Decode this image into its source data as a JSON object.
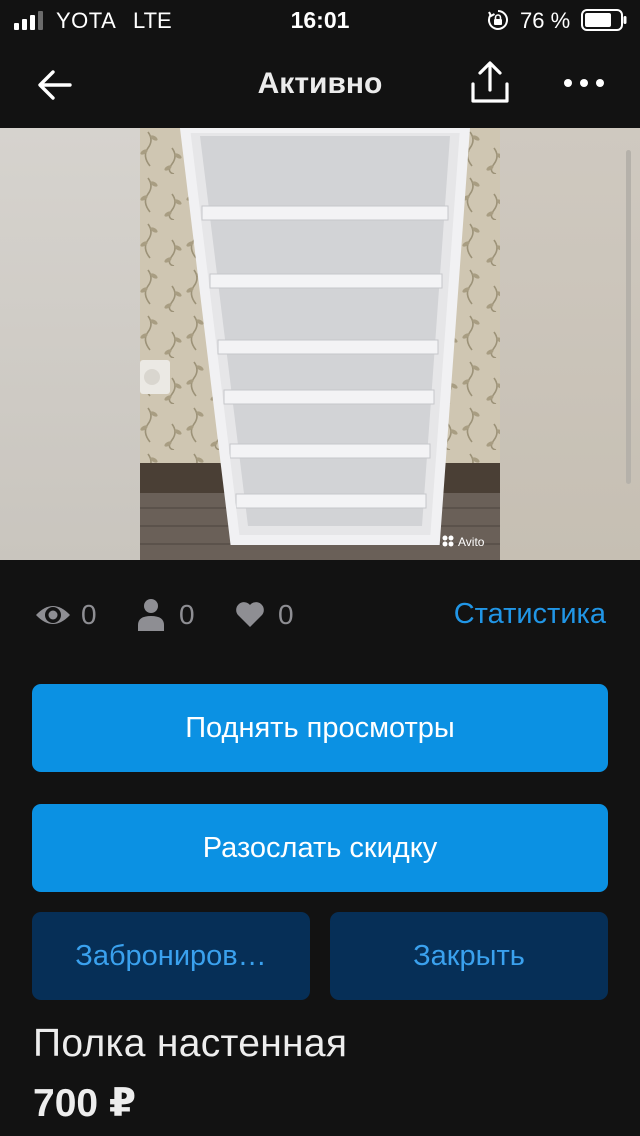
{
  "status_bar": {
    "carrier": "YOTA",
    "network": "LTE",
    "time": "16:01",
    "battery_percent": "76 %",
    "icons": [
      "signal-icon",
      "orientation-lock-icon",
      "battery-icon"
    ]
  },
  "nav": {
    "title": "Активно",
    "icons": [
      "back-arrow-icon",
      "share-icon",
      "more-icon"
    ]
  },
  "photo": {
    "watermark": "Avito"
  },
  "stats": {
    "views": "0",
    "contacts": "0",
    "favorites": "0",
    "link_label": "Статистика",
    "icons": [
      "eye-icon",
      "person-icon",
      "heart-icon"
    ]
  },
  "actions": {
    "boost_views": "Поднять просмотры",
    "send_discount": "Разослать скидку",
    "reserve": "Заброниров…",
    "close": "Закрыть"
  },
  "listing": {
    "title": "Полка настенная",
    "price": "700 ₽"
  },
  "colors": {
    "background": "#121212",
    "primary_button": "#0b91e3",
    "secondary_button": "#062f57",
    "link": "#2196e6",
    "muted": "#8e8e93"
  }
}
